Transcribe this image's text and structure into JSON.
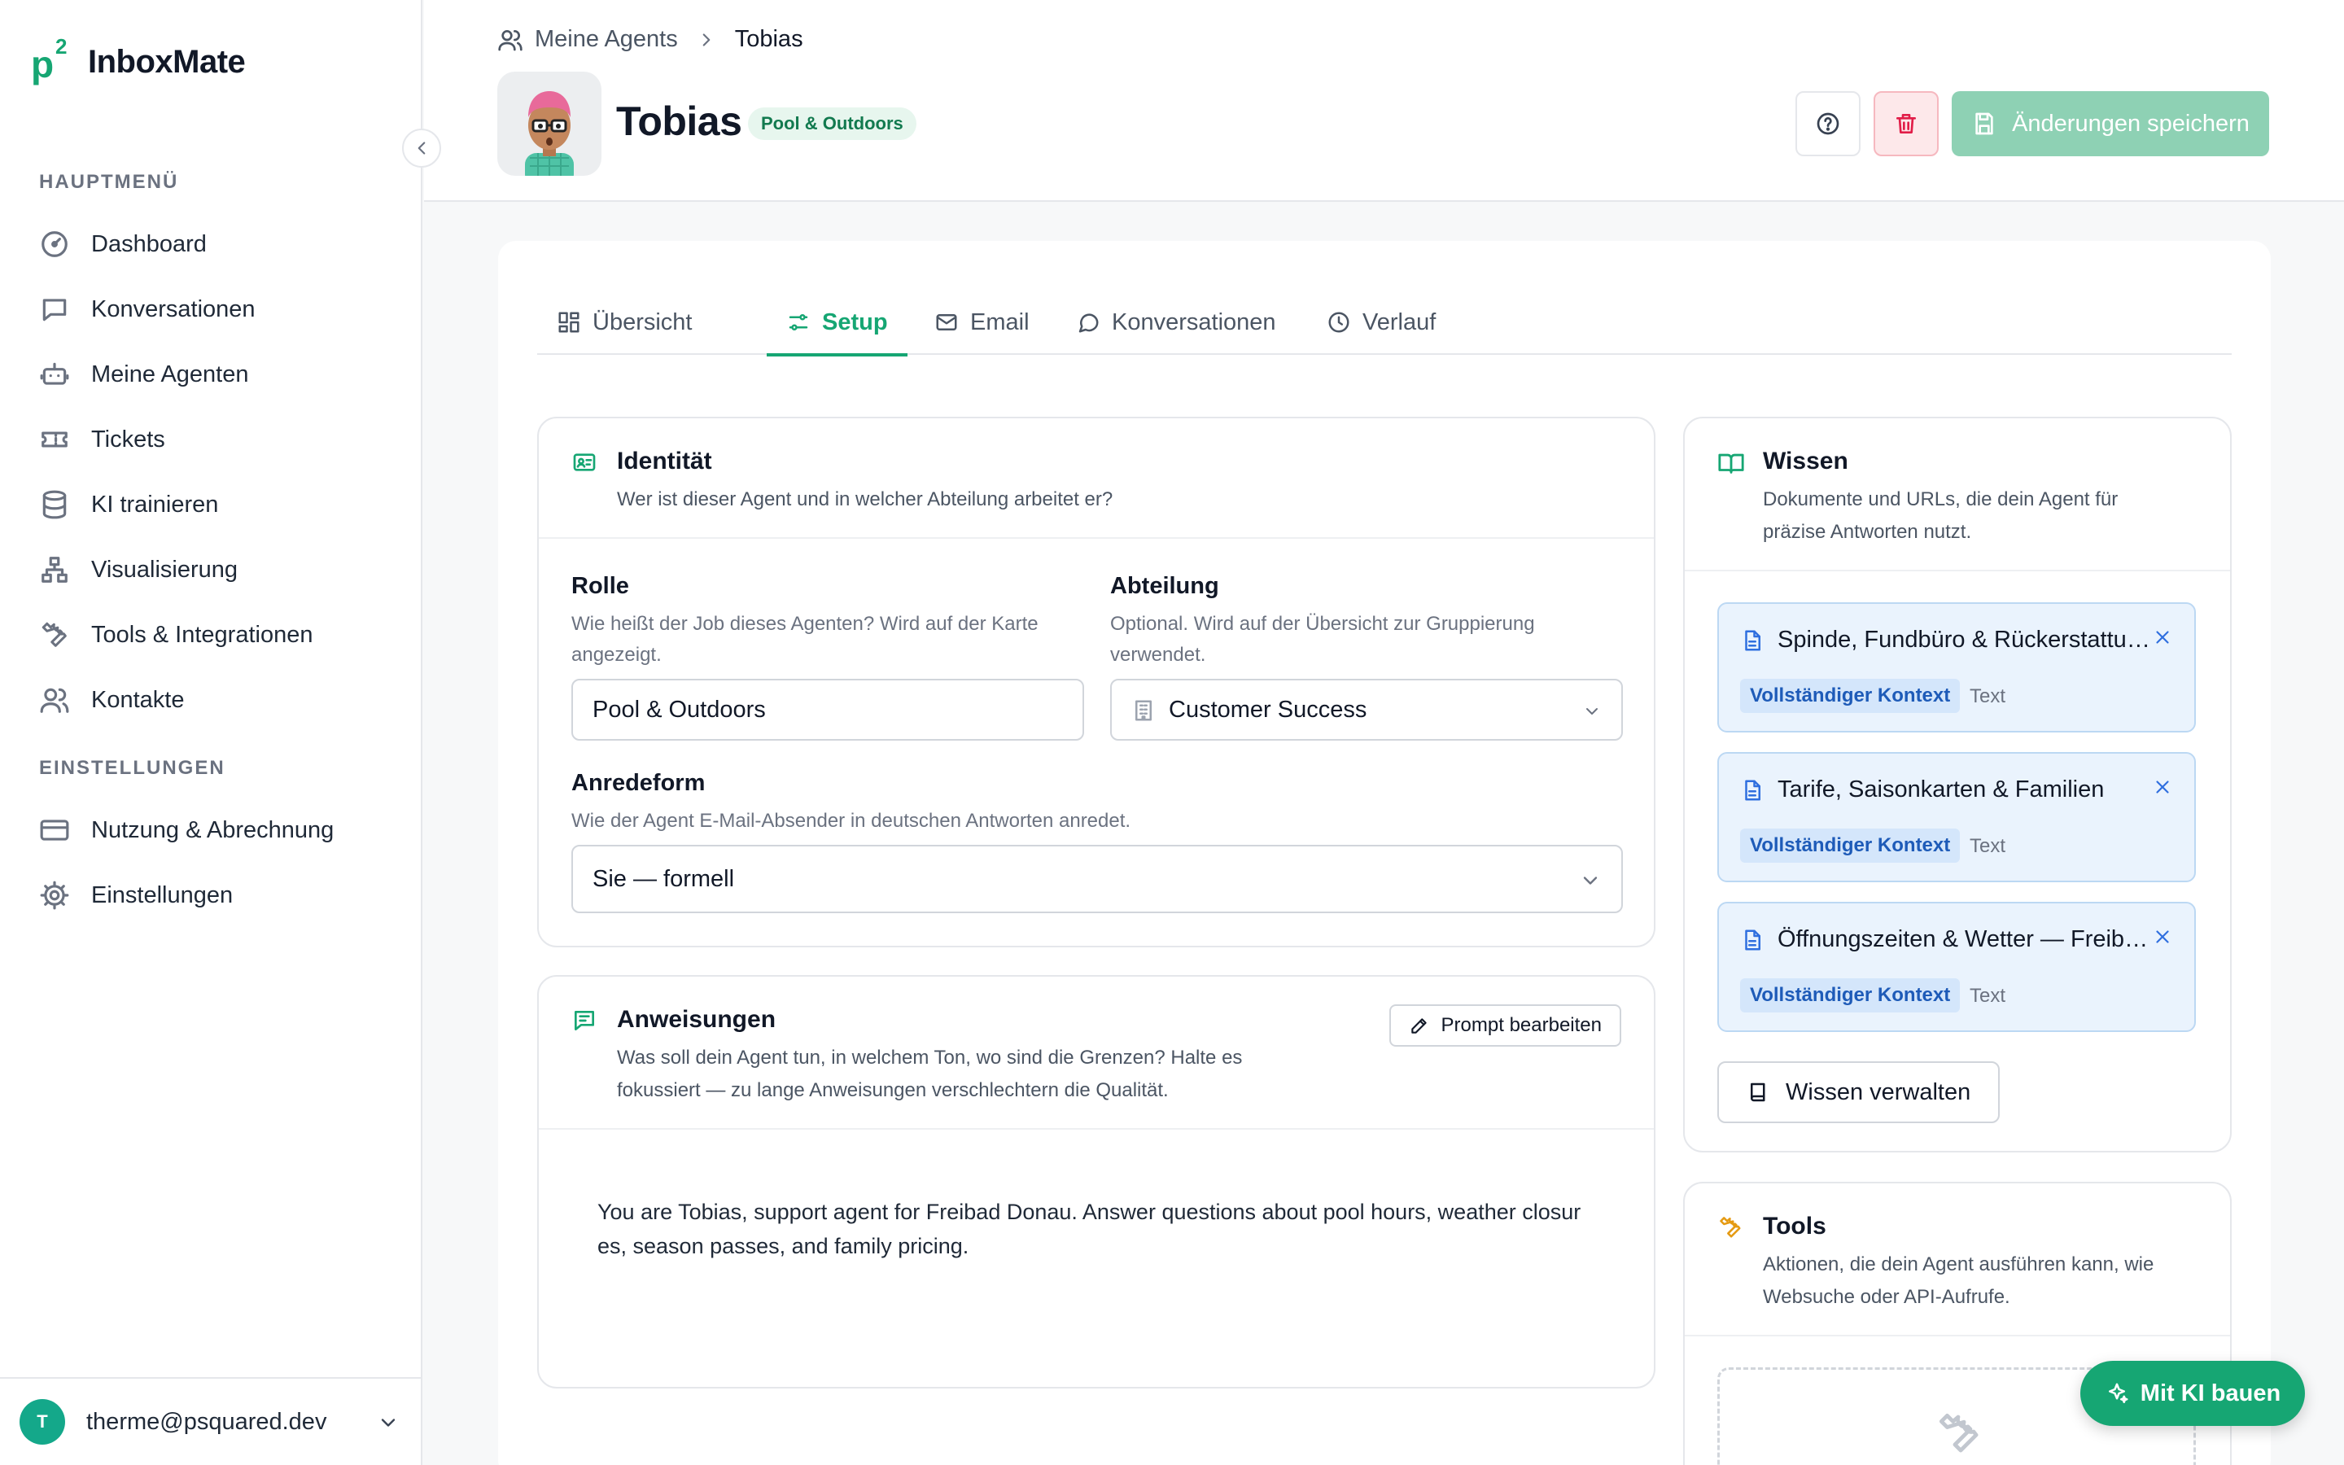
{
  "app": {
    "name": "InboxMate",
    "logo_letter": "p",
    "logo_sup": "2"
  },
  "sidebar": {
    "section_main": "HAUPTMENÜ",
    "section_settings": "EINSTELLUNGEN",
    "items": [
      {
        "label": "Dashboard",
        "icon": "gauge-icon"
      },
      {
        "label": "Konversationen",
        "icon": "chat-icon"
      },
      {
        "label": "Meine Agenten",
        "icon": "robot-icon"
      },
      {
        "label": "Tickets",
        "icon": "ticket-icon"
      },
      {
        "label": "KI trainieren",
        "icon": "database-icon"
      },
      {
        "label": "Visualisierung",
        "icon": "hierarchy-icon"
      },
      {
        "label": "Tools & Integrationen",
        "icon": "wrench-icon"
      },
      {
        "label": "Kontakte",
        "icon": "users-icon"
      }
    ],
    "settings_items": [
      {
        "label": "Nutzung & Abrechnung",
        "icon": "credit-card-icon"
      },
      {
        "label": "Einstellungen",
        "icon": "gear-icon"
      }
    ],
    "user": {
      "initial": "T",
      "email": "therme@psquared.dev"
    }
  },
  "header": {
    "breadcrumb": {
      "parent": "Meine Agents",
      "current": "Tobias"
    },
    "agent_name": "Tobias",
    "department_badge": "Pool & Outdoors",
    "save_label": "Änderungen speichern"
  },
  "tabs": [
    {
      "label": "Übersicht",
      "active": false
    },
    {
      "label": "Setup",
      "active": true
    },
    {
      "label": "Email",
      "active": false
    },
    {
      "label": "Konversationen",
      "active": false
    },
    {
      "label": "Verlauf",
      "active": false
    }
  ],
  "identity": {
    "title": "Identität",
    "subtitle": "Wer ist dieser Agent und in welcher Abteilung arbeitet er?",
    "role_label": "Rolle",
    "role_help_1": "Wie heißt der Job dieses Agenten? Wird auf der Karte",
    "role_help_2": "angezeigt.",
    "role_value": "Pool & Outdoors",
    "dept_label": "Abteilung",
    "dept_help_1": "Optional. Wird auf der Übersicht zur Gruppierung",
    "dept_help_2": "verwendet.",
    "dept_value": "Customer Success",
    "salutation_label": "Anredeform",
    "salutation_help": "Wie der Agent E-Mail-Absender in deutschen Antworten anredet.",
    "salutation_value": "Sie — formell"
  },
  "instructions": {
    "title": "Anweisungen",
    "subtitle_1": "Was soll dein Agent tun, in welchem Ton, wo sind die Grenzen? Halte es",
    "subtitle_2": "fokussiert — zu lange Anweisungen verschlechtern die Qualität.",
    "edit_label": "Prompt bearbeiten",
    "prompt_1": "You are Tobias, support agent for Freibad Donau. Answer questions about pool hours, weather closur",
    "prompt_2": "es, season passes, and family pricing."
  },
  "knowledge": {
    "title": "Wissen",
    "subtitle_1": "Dokumente und URLs, die dein Agent für",
    "subtitle_2": "präzise Antworten nutzt.",
    "items": [
      {
        "title": "Spinde, Fundbüro & Rückerstattungen",
        "badge": "Vollständiger Kontext",
        "type": "Text"
      },
      {
        "title": "Tarife, Saisonkarten & Familien",
        "badge": "Vollständiger Kontext",
        "type": "Text"
      },
      {
        "title": "Öffnungszeiten & Wetter — Freibad Donau",
        "badge": "Vollständiger Kontext",
        "type": "Text"
      }
    ],
    "manage_label": "Wissen verwalten"
  },
  "tools": {
    "title": "Tools",
    "subtitle_1": "Aktionen, die dein Agent ausführen kann, wie",
    "subtitle_2": "Websuche oder API-Aufrufe."
  },
  "ai_button": "Mit KI bauen",
  "colors": {
    "accent": "#16a673",
    "danger": "#e11d48",
    "knowledge": "#2f6fdf"
  }
}
